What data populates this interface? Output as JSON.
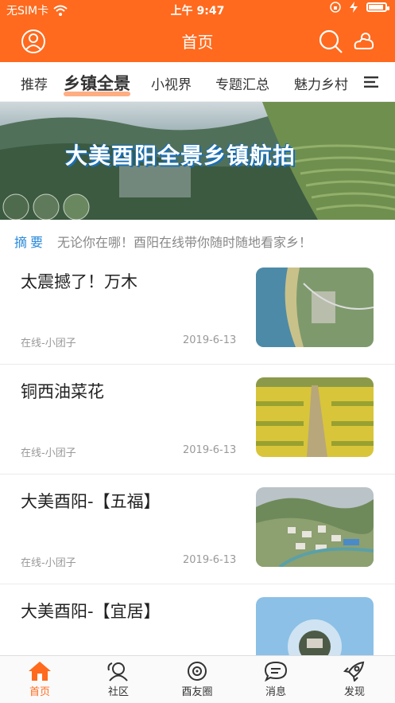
{
  "status_bar": {
    "carrier": "无SIM卡",
    "time": "上午 9:47",
    "battery_percent": 80
  },
  "header": {
    "title": "首页"
  },
  "tabs": [
    {
      "label": "推荐",
      "active": false
    },
    {
      "label": "乡镇全景",
      "active": true
    },
    {
      "label": "小视界",
      "active": false
    },
    {
      "label": "专题汇总",
      "active": false
    },
    {
      "label": "魅力乡村",
      "active": false
    }
  ],
  "banner": {
    "title": "大美酉阳全景乡镇航拍"
  },
  "summary": {
    "label": "摘要",
    "text": "无论你在哪！酉阳在线带你随时随地看家乡！"
  },
  "articles": [
    {
      "title": "太震撼了！万木",
      "author": "在线-小团子",
      "date": "2019-6-13"
    },
    {
      "title": "铜西油菜花",
      "author": "在线-小团子",
      "date": "2019-6-13"
    },
    {
      "title": "大美酉阳-【五福】",
      "author": "在线-小团子",
      "date": "2019-6-13"
    },
    {
      "title": "大美酉阳-【宜居】",
      "author": "",
      "date": ""
    }
  ],
  "bottom_nav": [
    {
      "label": "首页",
      "icon": "home-icon",
      "active": true
    },
    {
      "label": "社区",
      "icon": "community-icon",
      "active": false
    },
    {
      "label": "酉友圈",
      "icon": "moments-icon",
      "active": false
    },
    {
      "label": "消息",
      "icon": "message-icon",
      "active": false
    },
    {
      "label": "发现",
      "icon": "rocket-icon",
      "active": false
    }
  ],
  "colors": {
    "accent": "#ff6a1e",
    "link": "#2a8ad8"
  }
}
